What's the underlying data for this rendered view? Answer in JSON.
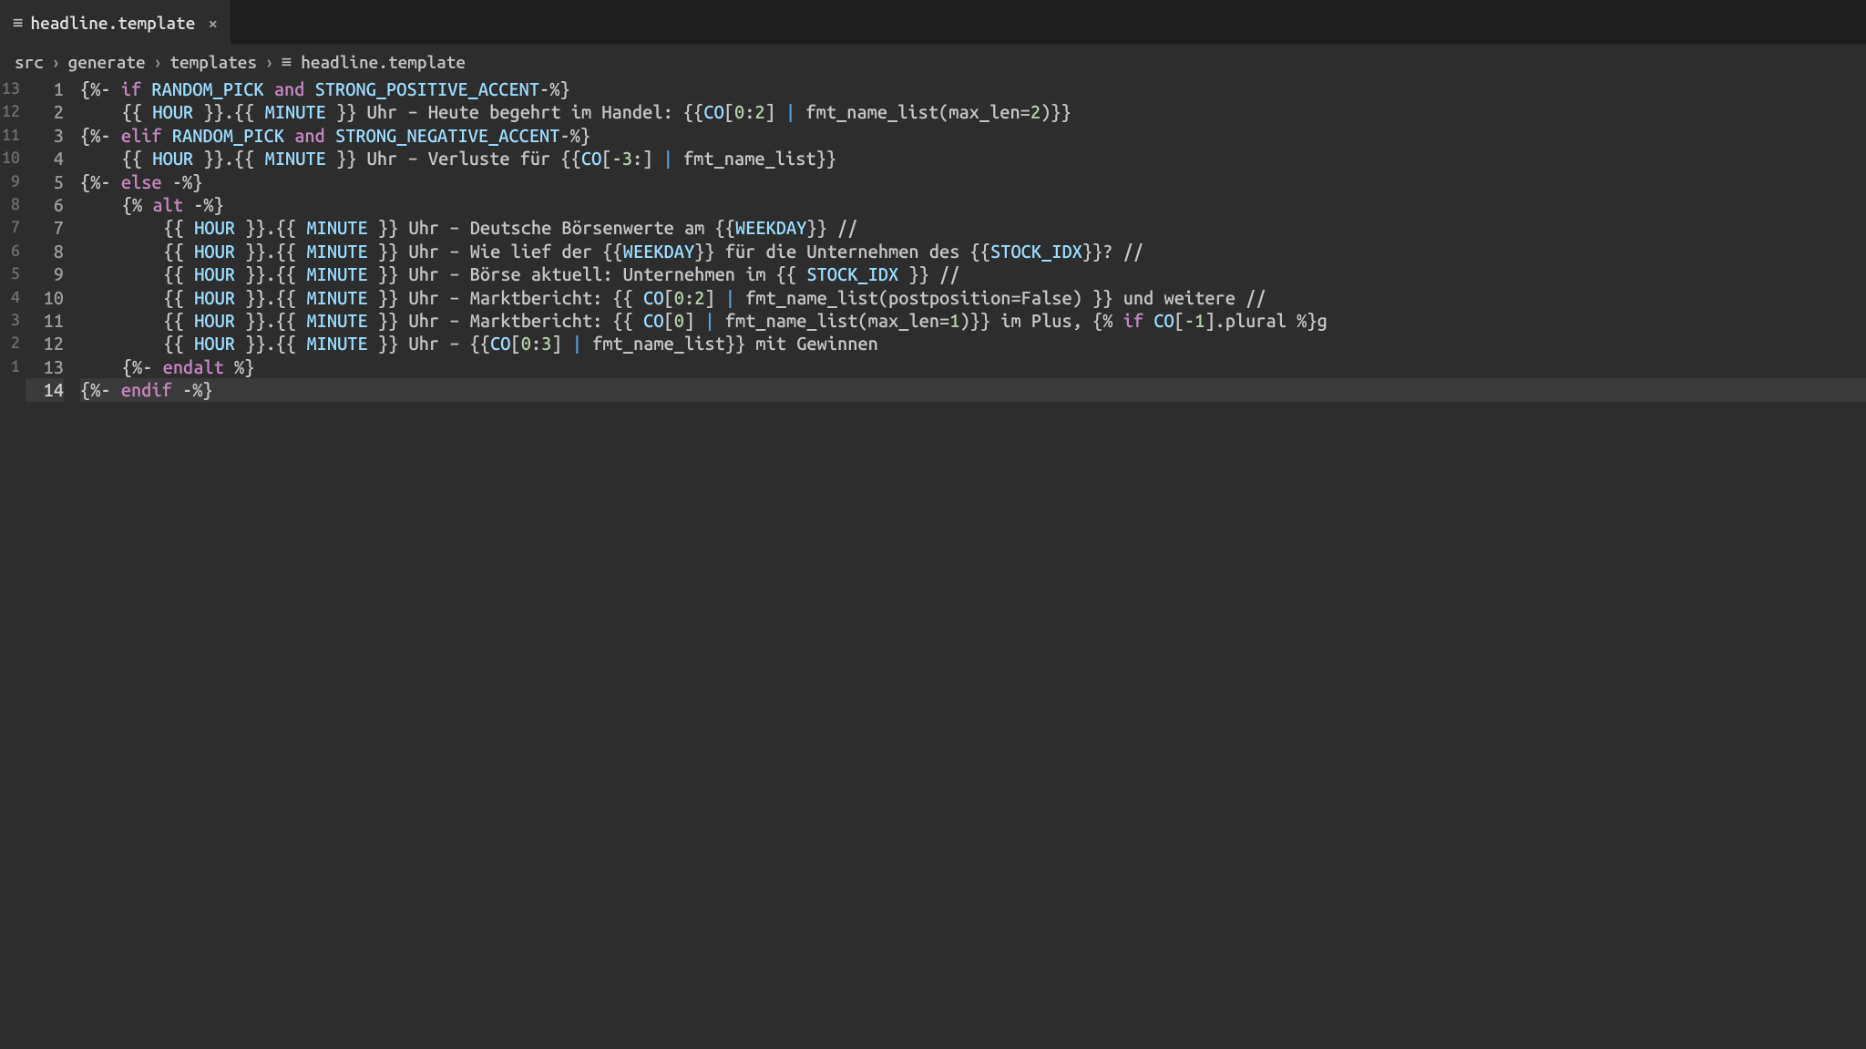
{
  "tab": {
    "label": "headline.template",
    "iconText": "≡",
    "closeGlyph": "×"
  },
  "breadcrumbs": {
    "sep": "›",
    "iconText": "≡",
    "parts": [
      "src",
      "generate",
      "templates",
      "headline.template"
    ]
  },
  "diffGutter": [
    "13",
    "12",
    "11",
    "10",
    "9",
    "8",
    "7",
    "6",
    "5",
    "4",
    "3",
    "2",
    "1",
    ""
  ],
  "lineGutter": [
    "1",
    "2",
    "3",
    "4",
    "5",
    "6",
    "7",
    "8",
    "9",
    "10",
    "11",
    "12",
    "13",
    "14"
  ],
  "currentLine": 14,
  "code": [
    "{%- if RANDOM_PICK and STRONG_POSITIVE_ACCENT-%}",
    "    {{ HOUR }}.{{ MINUTE }} Uhr – Heute begehrt im Handel: {{CO[0:2] | fmt_name_list(max_len=2)}}",
    "{%- elif RANDOM_PICK and STRONG_NEGATIVE_ACCENT-%}",
    "    {{ HOUR }}.{{ MINUTE }} Uhr – Verluste für {{CO[-3:] | fmt_name_list}}",
    "{%- else -%}",
    "    {% alt -%}",
    "        {{ HOUR }}.{{ MINUTE }} Uhr – Deutsche Börsenwerte am {{WEEKDAY}} //",
    "        {{ HOUR }}.{{ MINUTE }} Uhr – Wie lief der {{WEEKDAY}} für die Unternehmen des {{STOCK_IDX}}? //",
    "        {{ HOUR }}.{{ MINUTE }} Uhr – Börse aktuell: Unternehmen im {{ STOCK_IDX }} //",
    "        {{ HOUR }}.{{ MINUTE }} Uhr – Marktbericht: {{ CO[0:2] | fmt_name_list(postposition=False) }} und weitere //",
    "        {{ HOUR }}.{{ MINUTE }} Uhr – Marktbericht: {{ CO[0] | fmt_name_list(max_len=1)}} im Plus, {% if CO[-1].plural %}g",
    "        {{ HOUR }}.{{ MINUTE }} Uhr – {{CO[0:3] | fmt_name_list}} mit Gewinnen",
    "    {%- endalt %}",
    "{%- endif -%}"
  ]
}
